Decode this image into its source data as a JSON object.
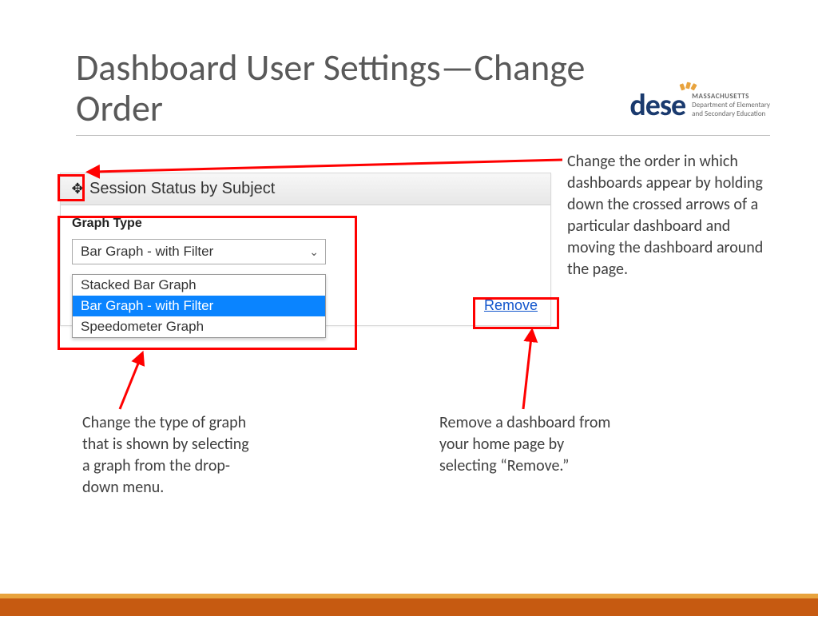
{
  "title": "Dashboard User Settings—Change Order",
  "logo": {
    "main": "dese",
    "line1": "MASSACHUSETTS",
    "line2": "Department of Elementary",
    "line3": "and Secondary Education"
  },
  "panel": {
    "title": "Session Status by Subject",
    "graph_type_label": "Graph Type",
    "selected": "Bar Graph - with Filter",
    "options": [
      "Stacked Bar Graph",
      "Bar Graph - with Filter",
      "Speedometer Graph"
    ],
    "remove_label": "Remove"
  },
  "notes": {
    "order": "Change the order in which dashboards appear by holding down the crossed arrows of a particular dashboard and moving the dashboard around the page.",
    "graph": "Change the type of graph that is shown by selecting a graph from the drop-down menu.",
    "remove": "Remove a dashboard from your home page by selecting “Remove.”"
  }
}
